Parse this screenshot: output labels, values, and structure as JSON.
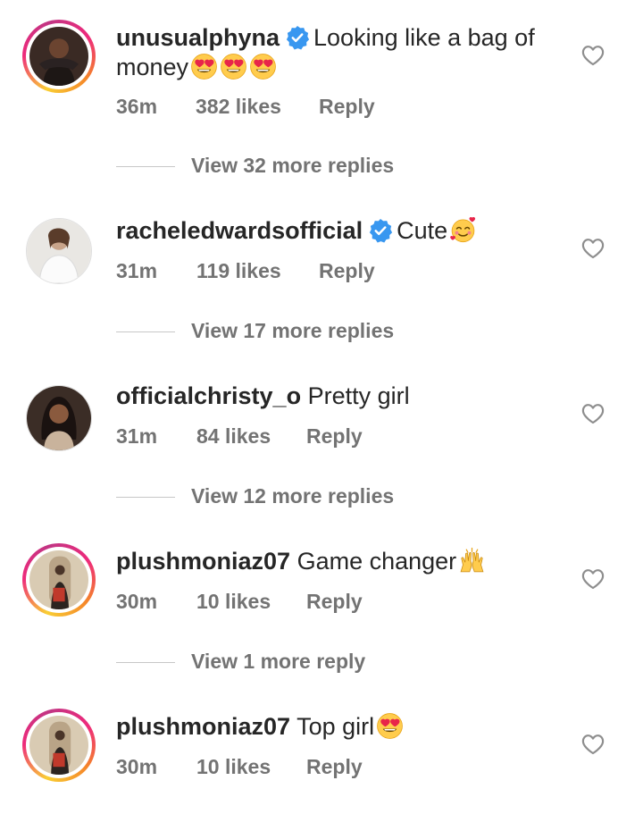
{
  "comments": [
    {
      "username": "unusualphyna",
      "verified": true,
      "text": "Looking like a bag of",
      "text2": "money",
      "emojis": [
        "heart-eyes",
        "heart-eyes",
        "heart-eyes"
      ],
      "time": "36m",
      "likes": "382 likes",
      "reply": "Reply",
      "replies_label": "View 32 more replies",
      "story_ring": true
    },
    {
      "username": "racheledwardsofficial",
      "verified": true,
      "text": "Cute",
      "emojis": [
        "smiling-hearts"
      ],
      "time": "31m",
      "likes": "119 likes",
      "reply": "Reply",
      "replies_label": "View 17 more replies",
      "story_ring": false
    },
    {
      "username": "officialchristy_o",
      "verified": false,
      "text": "Pretty girl",
      "time": "31m",
      "likes": "84 likes",
      "reply": "Reply",
      "replies_label": "View 12 more replies",
      "story_ring": false
    },
    {
      "username": "plushmoniaz07",
      "verified": false,
      "text": "Game changer",
      "emojis": [
        "raising-hands"
      ],
      "time": "30m",
      "likes": "10 likes",
      "reply": "Reply",
      "replies_label": "View 1 more reply",
      "story_ring": true
    },
    {
      "username": "plushmoniaz07",
      "verified": false,
      "text": "Top girl",
      "emojis": [
        "heart-eyes"
      ],
      "time": "30m",
      "likes": "10 likes",
      "reply": "Reply",
      "story_ring": true
    }
  ],
  "colors": {
    "verified_blue": "#3897f0",
    "meta_gray": "#737373",
    "text": "#262626"
  }
}
